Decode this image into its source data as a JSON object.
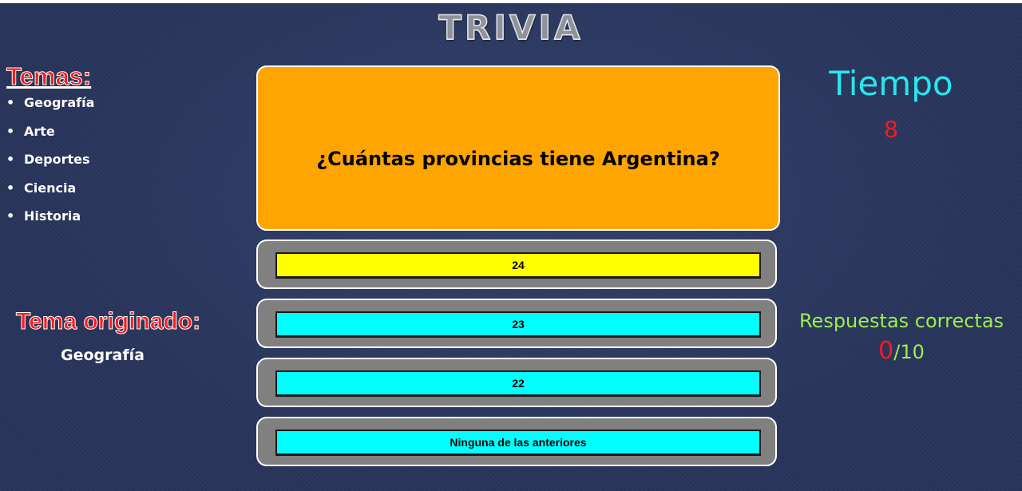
{
  "title": "TRIVIA",
  "temas": {
    "heading": "Temas:",
    "items": [
      "Geografía",
      "Arte",
      "Deportes",
      "Ciencia",
      "Historia"
    ]
  },
  "tema_originado": {
    "heading": "Tema originado:",
    "value": "Geografía"
  },
  "question": "¿Cuántas provincias tiene Argentina?",
  "answers": [
    {
      "label": "24",
      "selected": true
    },
    {
      "label": "23",
      "selected": false
    },
    {
      "label": "22",
      "selected": false
    },
    {
      "label": "Ninguna de las anteriores",
      "selected": false
    }
  ],
  "tiempo": {
    "label": "Tiempo",
    "value": "8"
  },
  "score": {
    "label": "Respuestas correctas",
    "correct": "0",
    "total_text": "/10"
  },
  "colors": {
    "question_bg": "#ffa500",
    "answer_bg": "#00ffff",
    "answer_selected_bg": "#ffff00",
    "frame_bg": "#808080",
    "heading_red": "#ff1a1a",
    "tiempo_cyan": "#26e8ee",
    "score_green": "#9dee4e"
  }
}
